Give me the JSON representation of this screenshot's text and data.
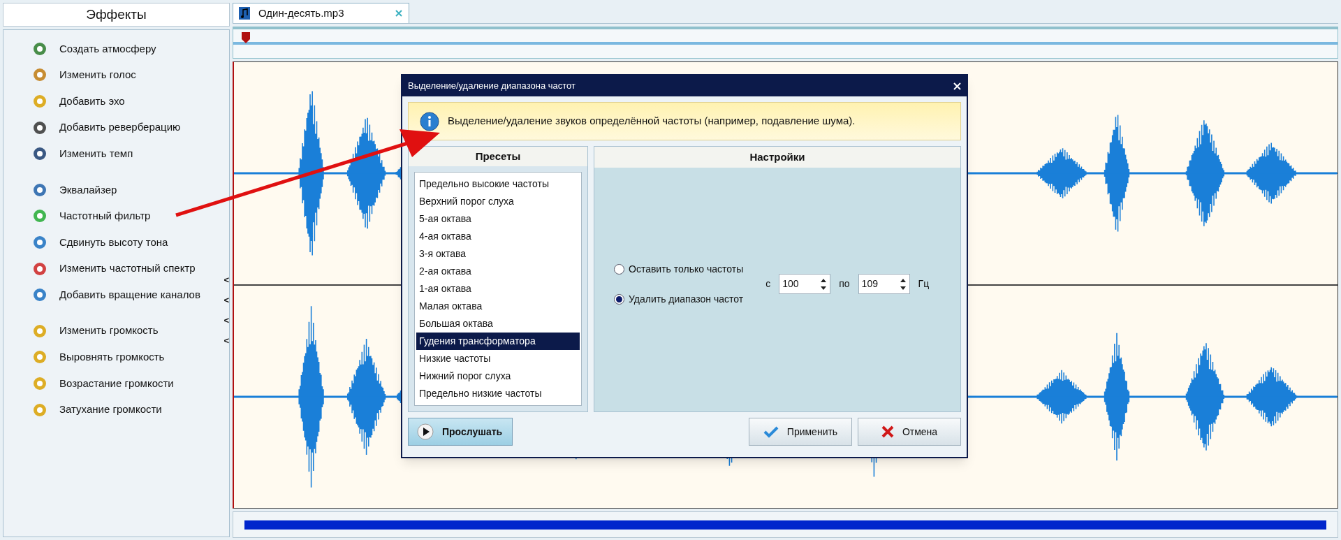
{
  "sidebar": {
    "title": "Эффекты",
    "groups": [
      [
        "Создать атмосферу",
        "Изменить голос",
        "Добавить эхо",
        "Добавить реверберацию",
        "Изменить темп"
      ],
      [
        "Эквалайзер",
        "Частотный фильтр",
        "Сдвинуть высоту тона",
        "Изменить частотный спектр",
        "Добавить вращение каналов"
      ],
      [
        "Изменить громкость",
        "Выровнять громкость",
        "Возрастание громкости",
        "Затухание громкости"
      ]
    ],
    "collapse_marks": [
      "<",
      "<",
      "<",
      "<"
    ]
  },
  "tabs": [
    {
      "label": "Один-десять.mp3",
      "selected": true
    }
  ],
  "dialog": {
    "title": "Выделение/удаление диапазона частот",
    "info": "Выделение/удаление звуков определённой частоты (например, подавление шума).",
    "presets_header": "Пресеты",
    "settings_header": "Настройки",
    "presets": [
      {
        "label": "Предельно высокие частоты",
        "selected": false
      },
      {
        "label": "Верхний порог слуха",
        "selected": false
      },
      {
        "label": "5-ая октава",
        "selected": false
      },
      {
        "label": "4-ая октава",
        "selected": false
      },
      {
        "label": "3-я октава",
        "selected": false
      },
      {
        "label": "2-ая октава",
        "selected": false
      },
      {
        "label": "1-ая октава",
        "selected": false
      },
      {
        "label": "Малая октава",
        "selected": false
      },
      {
        "label": "Большая октава",
        "selected": false
      },
      {
        "label": "Гудения трансформатора",
        "selected": true
      },
      {
        "label": "Низкие частоты",
        "selected": false
      },
      {
        "label": "Нижний порог слуха",
        "selected": false
      },
      {
        "label": "Предельно низкие частоты",
        "selected": false
      }
    ],
    "modes": [
      {
        "label": "Оставить только частоты",
        "selected": false
      },
      {
        "label": "Удалить диапазон частот",
        "selected": true
      }
    ],
    "from_label": "с",
    "from_value": "100",
    "to_label": "по",
    "to_value": "109",
    "unit": "Гц",
    "listen_button": "Прослушать",
    "apply_button": "Применить",
    "cancel_button": "Отмена"
  }
}
